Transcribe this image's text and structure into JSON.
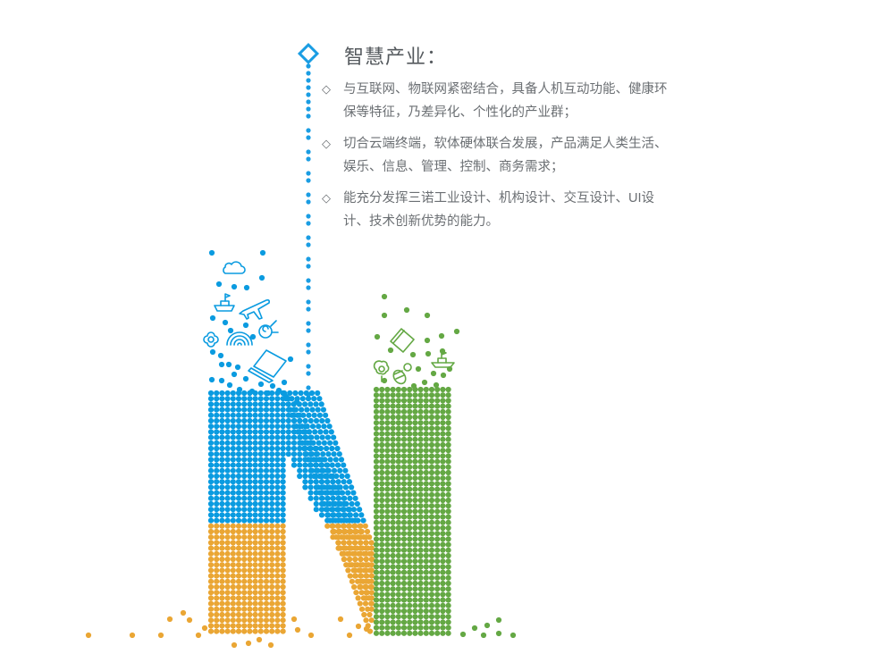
{
  "section": {
    "title": "智慧产业：",
    "bullets": [
      {
        "marker": "◇",
        "text": "与互联网、物联网紧密结合，具备人机互动功能、健康环保等特征，乃差异化、个性化的产业群；"
      },
      {
        "marker": "◇",
        "text": "切合云端终端，软体硬体联合发展，产品满足人类生活、娱乐、信息、管理、控制、商务需求；"
      },
      {
        "marker": "◇",
        "text": "能充分发挥三诺工业设计、机构设计、交互设计、UI设计、技术创新优势的能力。"
      }
    ]
  },
  "graphic": {
    "letter": "N",
    "colors": {
      "blue": "#0a9be0",
      "orange": "#eaa634",
      "green": "#64a844",
      "accent": "#1a9de3"
    },
    "icons": [
      "cloud-icon",
      "ship-icon",
      "airplane-icon",
      "satellite-icon",
      "wifi-icon",
      "flower-icon",
      "laptop-icon",
      "book-icon",
      "bee-icon",
      "plant-icon",
      "boat-icon"
    ]
  }
}
